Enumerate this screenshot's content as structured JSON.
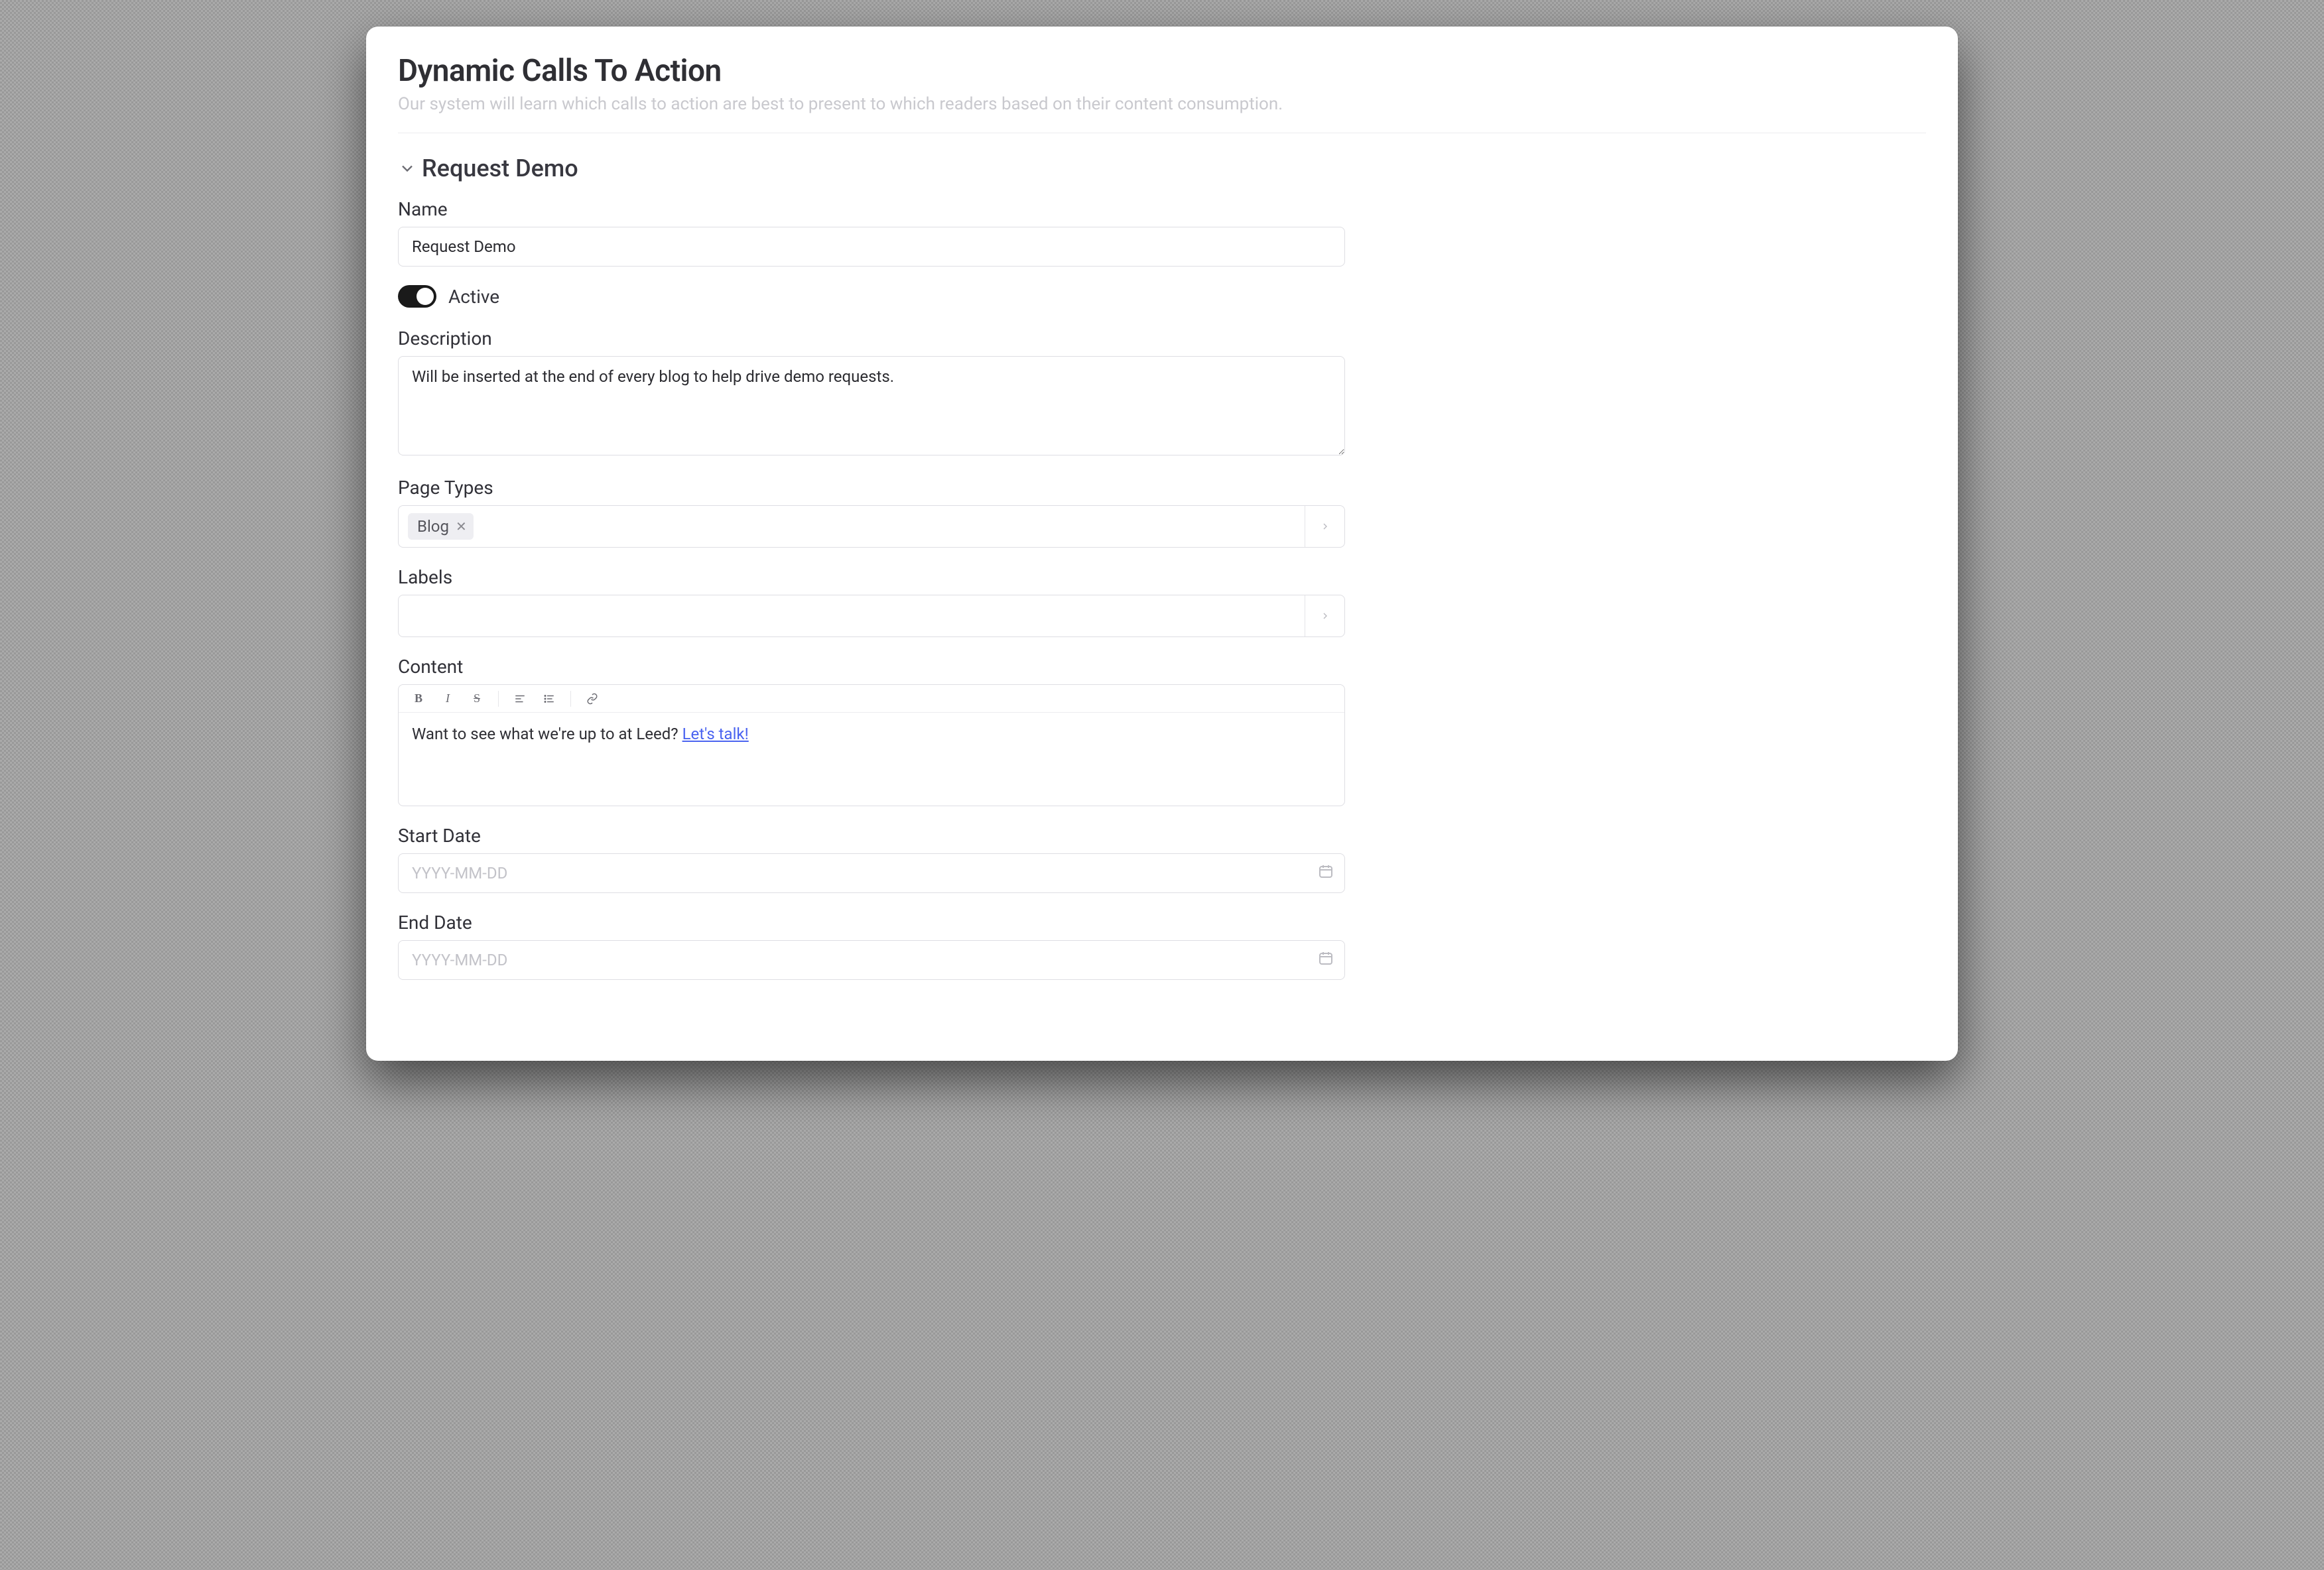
{
  "header": {
    "title": "Dynamic Calls To Action",
    "subtitle": "Our system will learn which calls to action are best to present to which readers based on their content consumption."
  },
  "section": {
    "title": "Request Demo"
  },
  "fields": {
    "name": {
      "label": "Name",
      "value": "Request Demo"
    },
    "active": {
      "label": "Active",
      "value": true
    },
    "description": {
      "label": "Description",
      "value": "Will be inserted at the end of every blog to help drive demo requests."
    },
    "pageTypes": {
      "label": "Page Types",
      "chips": [
        "Blog"
      ]
    },
    "labels": {
      "label": "Labels",
      "chips": []
    },
    "content": {
      "label": "Content",
      "text_before_link": "Want to see what we're up to at Leed? ",
      "link_text": "Let's talk!"
    },
    "startDate": {
      "label": "Start Date",
      "placeholder": "YYYY-MM-DD",
      "value": ""
    },
    "endDate": {
      "label": "End Date",
      "placeholder": "YYYY-MM-DD",
      "value": ""
    }
  },
  "toolbar": {
    "bold": "B",
    "italic": "I",
    "strike": "S"
  }
}
